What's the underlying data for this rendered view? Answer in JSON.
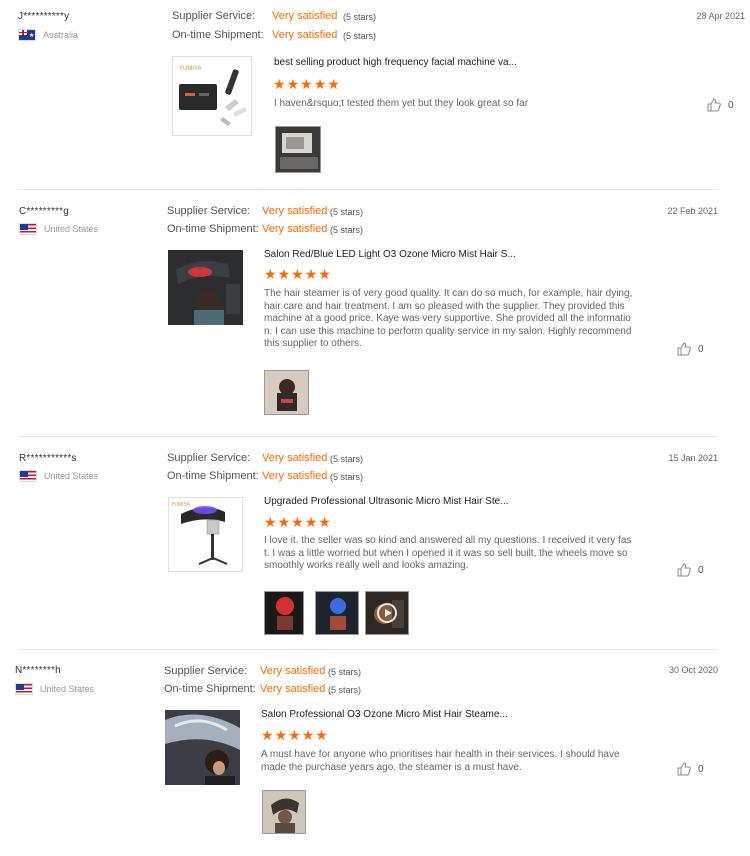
{
  "labels": {
    "supplier_service": "Supplier Service:",
    "ontime_shipment": "On-time Shipment:"
  },
  "colors": {
    "accent": "#ff6a00",
    "separator": "#e6e6e6"
  },
  "reviews": [
    {
      "user": "J**********y",
      "country": "Australia",
      "flag": "australia-flag",
      "date": "28 Apr 2021",
      "supplier_rating": "Very satisfied",
      "supplier_stars": "(5 stars)",
      "shipment_rating": "Very satisfied",
      "shipment_stars": "(5 stars)",
      "product_title": "best selling product high frequency facial machine va...",
      "rating": 5,
      "text": "I haven&rsquo;t tested them yet but they look great so far",
      "likes": "0",
      "images": [
        "photo"
      ]
    },
    {
      "user": "C*********g",
      "country": "United States",
      "flag": "usa-flag",
      "date": "22 Feb 2021",
      "supplier_rating": "Very satisfied",
      "supplier_stars": "(5 stars)",
      "shipment_rating": "Very satisfied",
      "shipment_stars": "(5 stars)",
      "product_title": "Salon Red/Blue LED Light O3 Ozone Micro Mist Hair S...",
      "rating": 5,
      "text": "The hair steamer is of very good quality. It can do so much, for example, hair dying, hair care and hair treatment. I am so pleased with the supplier. They provided this machine at a good price. Kaye was very supportive. She provided all the information. I can use this machine to perform quality service in my salon. Highly recommend this supplier to others.",
      "likes": "0",
      "images": [
        "photo"
      ]
    },
    {
      "user": "R***********s",
      "country": "United States",
      "flag": "usa-flag",
      "date": "15 Jan 2021",
      "supplier_rating": "Very satisfied",
      "supplier_stars": "(5 stars)",
      "shipment_rating": "Very satisfied",
      "shipment_stars": "(5 stars)",
      "product_title": "Upgraded Professional Ultrasonic Micro Mist Hair Ste...",
      "rating": 5,
      "text": "I love it. the seller was so kind and answered all my questions. I received it very fast. I was a little worried but when I opened it it was so sell built, the wheels move so smoothly works really well and looks amazing.",
      "likes": "0",
      "images": [
        "photo",
        "photo",
        "video"
      ]
    },
    {
      "user": "N********h",
      "country": "United States",
      "flag": "usa-flag",
      "date": "30 Oct 2020",
      "supplier_rating": "Very satisfied",
      "supplier_stars": "(5 stars)",
      "shipment_rating": "Very satisfied",
      "shipment_stars": "(5 stars)",
      "product_title": "Salon Professional O3 Ozone Micro Mist Hair Steame...",
      "rating": 5,
      "text": "A must have for anyone who prioritises hair health in their services.  I should have made the purchase years ago.  the steamer is a must have.",
      "likes": "0",
      "images": [
        "photo"
      ]
    }
  ]
}
